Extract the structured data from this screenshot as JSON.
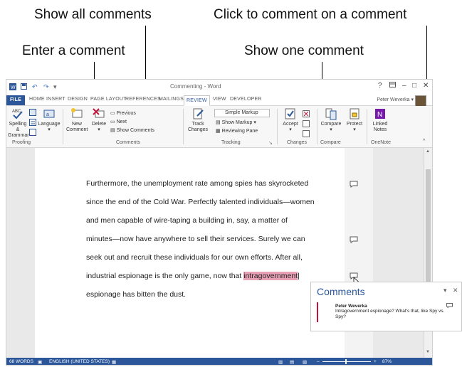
{
  "callouts": {
    "show_all": "Show all comments",
    "comment_on_comment": "Click to comment on a comment",
    "enter_comment": "Enter a comment",
    "show_one": "Show one comment"
  },
  "window": {
    "title": "Commenting - Word",
    "help": "?",
    "minimize": "–",
    "maximize": "□",
    "close": "✕"
  },
  "tabs": [
    "FILE",
    "HOME",
    "INSERT",
    "DESIGN",
    "PAGE LAYOUT",
    "REFERENCES",
    "MAILINGS",
    "REVIEW",
    "VIEW",
    "DEVELOPER"
  ],
  "active_tab": "REVIEW",
  "user_name": "Peter Weverka ▾",
  "ribbon": {
    "spelling_line1": "Spelling &",
    "spelling_line2": "Grammar",
    "language": "Language",
    "new_comment_line1": "New",
    "new_comment_line2": "Comment",
    "delete": "Delete",
    "previous": "Previous",
    "next": "Next",
    "show_comments": "Show Comments",
    "track_line1": "Track",
    "track_line2": "Changes",
    "simple_markup": "Simple Markup",
    "show_markup": "Show Markup ▾",
    "reviewing_pane": "Reviewing Pane",
    "accept": "Accept",
    "compare": "Compare",
    "protect": "Protect",
    "linked_line1": "Linked",
    "linked_line2": "Notes",
    "groups": {
      "proofing": "Proofing",
      "comments": "Comments",
      "tracking": "Tracking",
      "changes": "Changes",
      "compare": "Compare",
      "onenote": "OneNote"
    }
  },
  "document": {
    "lines": [
      "Furthermore, the unemployment rate among spies has skyrocketed",
      "since the end of the Cold War. Perfectly talented individuals—women",
      "and men capable of wire-taping a building in, say, a matter of",
      "minutes—now have anywhere to sell their services. Surely we can",
      "seek out and recruit these individuals for our own efforts. After all,",
      "industrial espionage is the only game, now that ",
      "espionage has bitten the dust."
    ],
    "highlighted": "intragovernment"
  },
  "status": {
    "words": "68 WORDS",
    "language": "ENGLISH (UNITED STATES)",
    "zoom_minus": "–",
    "zoom_plus": "+",
    "zoom": "87%"
  },
  "comments_pane": {
    "title": "Comments",
    "dropdown": "▾",
    "close": "✕",
    "author": "Peter Weverka",
    "text": "Intragovernment espionage? What's that, like Spy vs. Spy?"
  },
  "colors": {
    "word_blue": "#2b579a",
    "highlight": "#e8a0b4",
    "comment_bar": "#c0143c"
  }
}
